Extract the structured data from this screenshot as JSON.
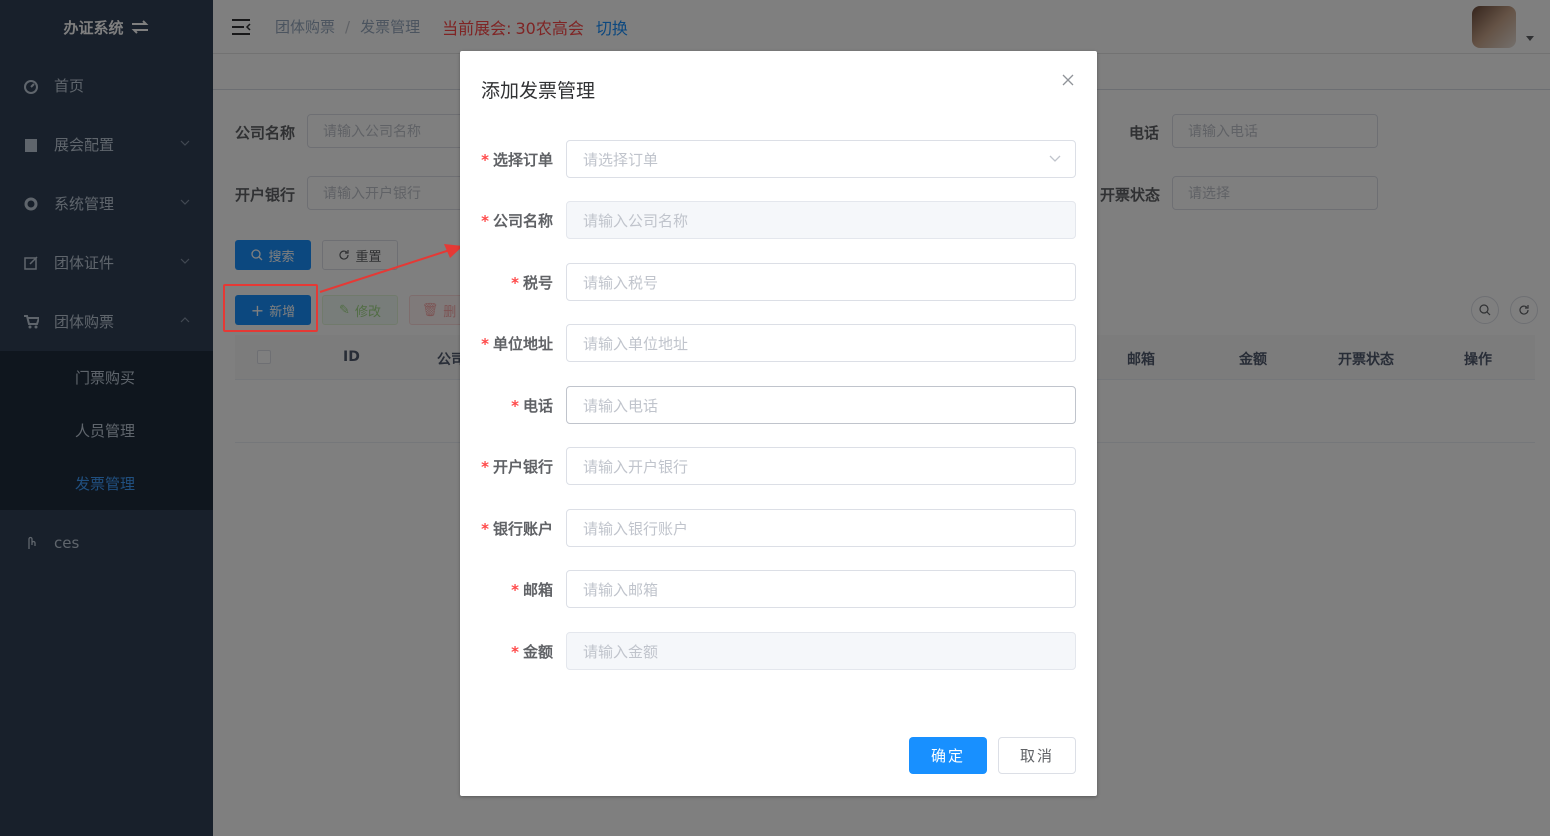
{
  "sidebar": {
    "logo": "办证系统",
    "menu": [
      {
        "label": "首页",
        "icon": "dashboard-icon"
      },
      {
        "label": "展会配置",
        "icon": "clipboard-icon"
      },
      {
        "label": "系统管理",
        "icon": "gear-icon"
      },
      {
        "label": "团体证件",
        "icon": "edit-icon"
      },
      {
        "label": "团体购票",
        "icon": "cart-icon"
      }
    ],
    "submenu": [
      {
        "label": "门票购买"
      },
      {
        "label": "人员管理"
      },
      {
        "label": "发票管理",
        "active": true
      }
    ],
    "extra": {
      "label": "ces",
      "icon": "hand-icon"
    }
  },
  "topbar": {
    "breadcrumb": [
      "团体购票",
      "发票管理"
    ],
    "current_expo_label": "当前展会:",
    "current_expo": "30农高会",
    "switch_label": "切换"
  },
  "search_form": {
    "company_label": "公司名称",
    "company_placeholder": "请输入公司名称",
    "phone_label": "电话",
    "phone_placeholder": "请输入电话",
    "bank_label": "开户银行",
    "bank_placeholder": "请输入开户银行",
    "status_label": "开票状态",
    "status_placeholder": "请选择",
    "search_btn": "搜索",
    "reset_btn": "重置"
  },
  "toolbar": {
    "add_btn": "新增",
    "edit_btn": "修改",
    "delete_btn": "删"
  },
  "table": {
    "headers": [
      "ID",
      "公司",
      "邮箱",
      "金额",
      "开票状态",
      "操作"
    ]
  },
  "dialog": {
    "title": "添加发票管理",
    "fields": [
      {
        "label": "选择订单",
        "placeholder": "请选择订单",
        "type": "select"
      },
      {
        "label": "公司名称",
        "placeholder": "请输入公司名称",
        "type": "disabled"
      },
      {
        "label": "税号",
        "placeholder": "请输入税号",
        "type": "text"
      },
      {
        "label": "单位地址",
        "placeholder": "请输入单位地址",
        "type": "text"
      },
      {
        "label": "电话",
        "placeholder": "请输入电话",
        "type": "focused"
      },
      {
        "label": "开户银行",
        "placeholder": "请输入开户银行",
        "type": "text"
      },
      {
        "label": "银行账户",
        "placeholder": "请输入银行账户",
        "type": "text"
      },
      {
        "label": "邮箱",
        "placeholder": "请输入邮箱",
        "type": "text"
      },
      {
        "label": "金额",
        "placeholder": "请输入金额",
        "type": "disabled"
      }
    ],
    "required_mark": "*",
    "ok_btn": "确定",
    "cancel_btn": "取消"
  },
  "colors": {
    "sidebar_bg": "#304156",
    "primary": "#1890ff",
    "danger": "#ff4949",
    "highlight": "#e53935"
  }
}
